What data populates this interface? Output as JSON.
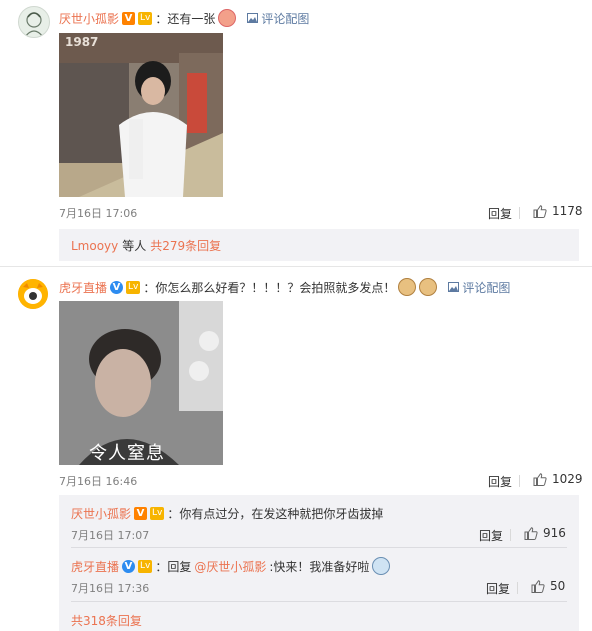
{
  "comments": [
    {
      "user": "厌世小孤影",
      "badges": [
        "V",
        "Lv"
      ],
      "text": "：还有一张",
      "pic_label": "评论配图",
      "photo_caption": "1987",
      "time": "7月16日 17:06",
      "reply_label": "回复",
      "likes": "1178",
      "thread_users": "Lmooyy",
      "thread_mid": "等人",
      "thread_count": "共279条回复"
    },
    {
      "user": "虎牙直播",
      "badges": [
        "V",
        "Lv"
      ],
      "text": "：你怎么那么好看？！！！？会拍照就多发点！",
      "pic_label": "评论配图",
      "photo_caption": "令人窒息",
      "time": "7月16日 16:46",
      "reply_label": "回复",
      "likes": "1029",
      "replies": [
        {
          "user": "厌世小孤影",
          "text": "：你有点过分，在发这种就把你牙齿拔掉",
          "time": "7月16日 17:07",
          "reply_label": "回复",
          "likes": "916"
        },
        {
          "user": "虎牙直播",
          "prefix": "：回复",
          "mention": "@厌世小孤影",
          "text": ":快来！我准备好啦",
          "time": "7月16日 17:36",
          "reply_label": "回复",
          "likes": "50"
        }
      ],
      "total_replies": "共318条回复"
    }
  ]
}
